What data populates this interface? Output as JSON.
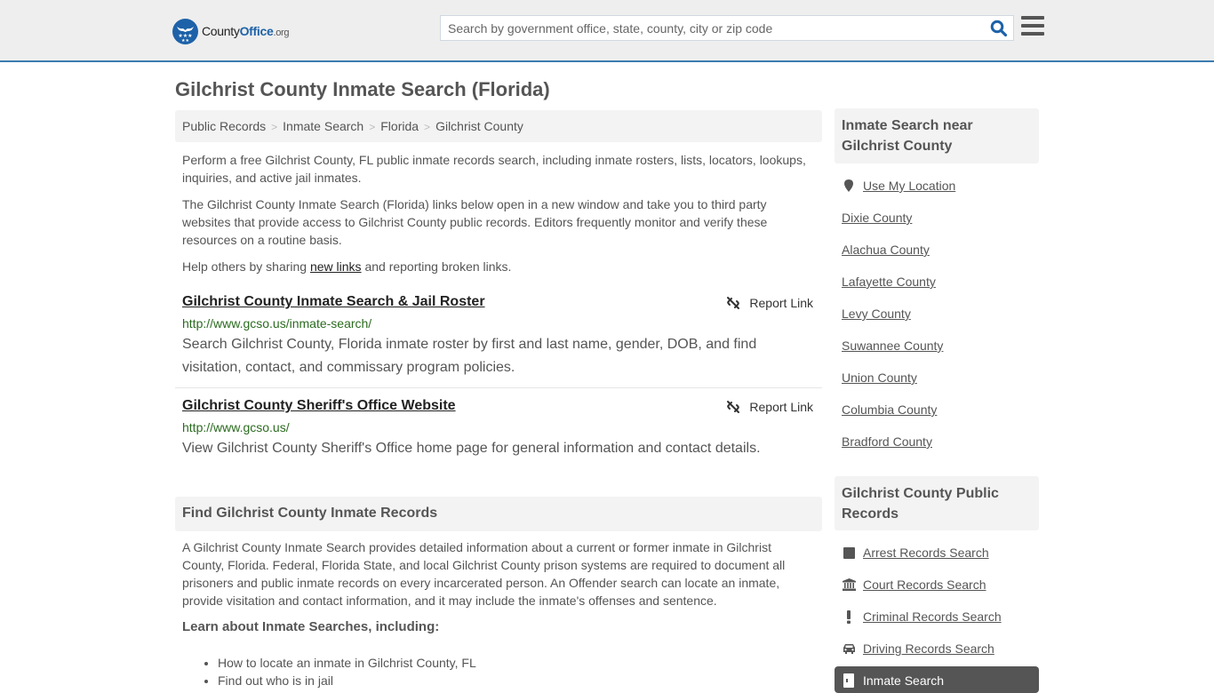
{
  "header": {
    "logo": {
      "text_county": "County",
      "text_office": "Office",
      "text_org": ".org"
    },
    "search": {
      "placeholder": "Search by government office, state, county, city or zip code",
      "value": ""
    },
    "colors": {
      "brand": "#1d62a8",
      "accent_border": "#3a7cb0",
      "url_green": "#2b6b1f"
    }
  },
  "page_title": "Gilchrist County Inmate Search (Florida)",
  "breadcrumb": [
    {
      "label": "Public Records"
    },
    {
      "label": "Inmate Search"
    },
    {
      "label": "Florida"
    },
    {
      "label": "Gilchrist County"
    }
  ],
  "breadcrumb_separator": ">",
  "intro": {
    "p1": "Perform a free Gilchrist County, FL public inmate records search, including inmate rosters, lists, locators, lookups, inquiries, and active jail inmates.",
    "p2": "The Gilchrist County Inmate Search (Florida) links below open in a new window and take you to third party websites that provide access to Gilchrist County public records. Editors frequently monitor and verify these resources on a routine basis.",
    "p3_before": "Help others by sharing ",
    "p3_link": "new links",
    "p3_after": " and reporting broken links."
  },
  "results": [
    {
      "title": "Gilchrist County Inmate Search & Jail Roster",
      "url": "http://www.gcso.us/inmate-search/",
      "description": "Search Gilchrist County, Florida inmate roster by first and last name, gender, DOB, and find visitation, contact, and commissary program policies.",
      "report_label": "Report Link"
    },
    {
      "title": "Gilchrist County Sheriff's Office Website",
      "url": "http://www.gcso.us/",
      "description": "View Gilchrist County Sheriff's Office home page for general information and contact details.",
      "report_label": "Report Link"
    }
  ],
  "find_section": {
    "heading": "Find Gilchrist County Inmate Records",
    "body": "A Gilchrist County Inmate Search provides detailed information about a current or former inmate in Gilchrist County, Florida. Federal, Florida State, and local Gilchrist County prison systems are required to document all prisoners and public inmate records on every incarcerated person. An Offender search can locate an inmate, provide visitation and contact information, and it may include the inmate's offenses and sentence.",
    "learn_heading": "Learn about Inmate Searches, including:",
    "bullets": [
      "How to locate an inmate in Gilchrist County, FL",
      "Find out who is in jail"
    ]
  },
  "sidebar": {
    "nearby": {
      "heading": "Inmate Search near Gilchrist County",
      "use_location": "Use My Location",
      "counties": [
        "Dixie County",
        "Alachua County",
        "Lafayette County",
        "Levy County",
        "Suwannee County",
        "Union County",
        "Columbia County",
        "Bradford County"
      ]
    },
    "public_records": {
      "heading": "Gilchrist County Public Records",
      "items": [
        {
          "label": "Arrest Records Search",
          "icon": "square-icon"
        },
        {
          "label": "Court Records Search",
          "icon": "courthouse-icon"
        },
        {
          "label": "Criminal Records Search",
          "icon": "exclamation-icon"
        },
        {
          "label": "Driving Records Search",
          "icon": "car-icon"
        },
        {
          "label": "Inmate Search",
          "icon": "door-icon",
          "active": true
        }
      ]
    }
  }
}
